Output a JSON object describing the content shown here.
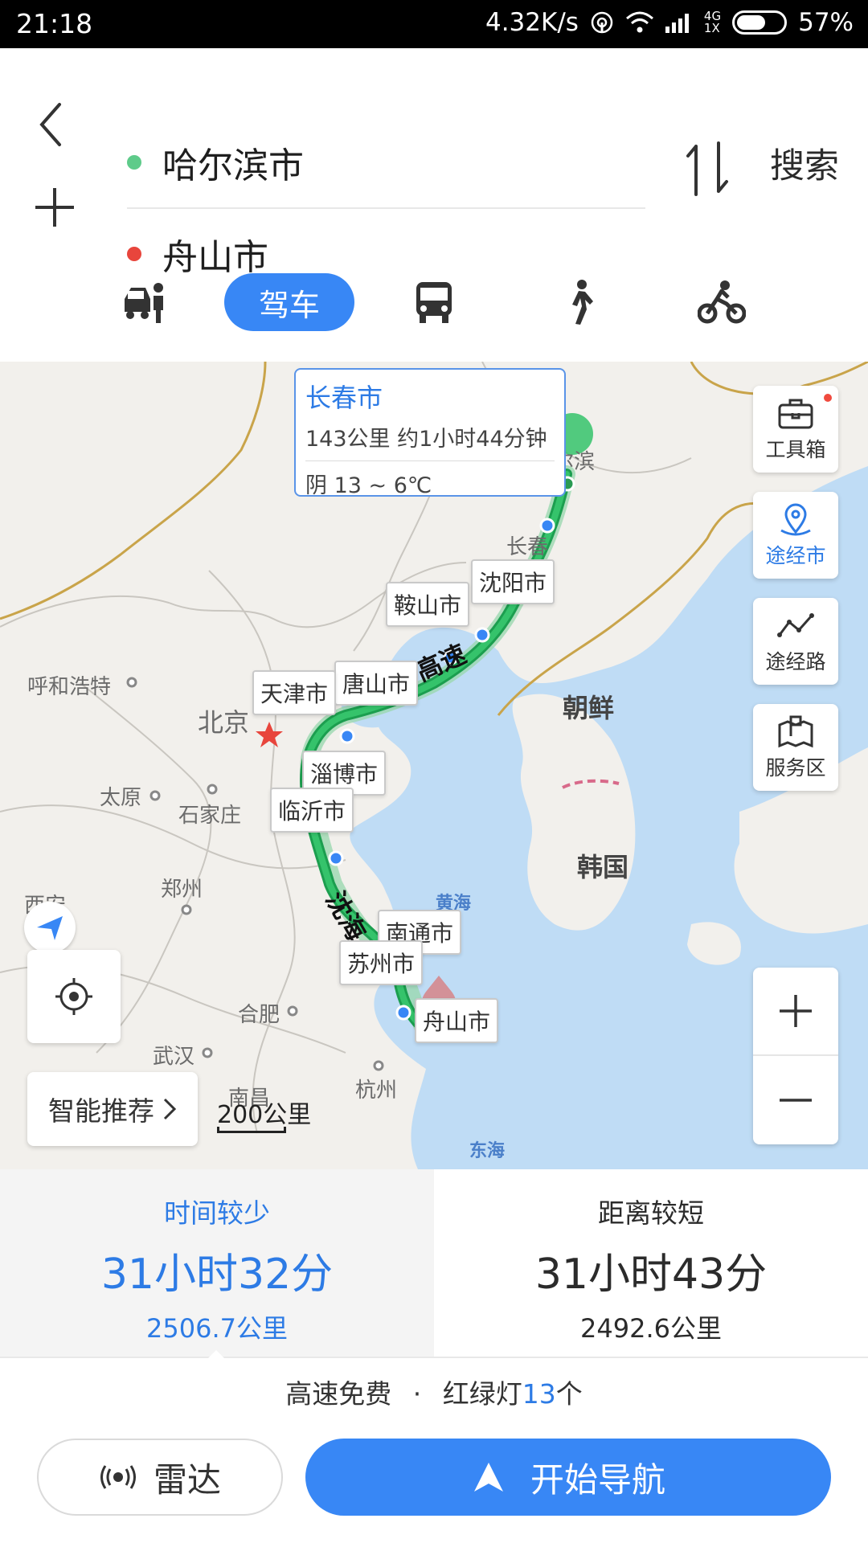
{
  "status_bar": {
    "time": "21:18",
    "net_speed": "4.32K/s",
    "network_type": "4G",
    "sim_label": "1X",
    "battery": "57%"
  },
  "route": {
    "origin": "哈尔滨市",
    "destination": "舟山市",
    "search_label": "搜索",
    "origin_color": "#5ecb8a",
    "destination_color": "#e8453c"
  },
  "modes": {
    "active_label": "驾车",
    "items": [
      "taxi-icon",
      "car",
      "bus-icon",
      "walk-icon",
      "bike-icon"
    ]
  },
  "map": {
    "info_card": {
      "city": "长春市",
      "detail": "143公里 约1小时44分钟",
      "weather": "阴 13 ~ 6℃"
    },
    "city_tags": [
      "沈阳市",
      "鞍山市",
      "唐山市",
      "天津市",
      "淄博市",
      "临沂市",
      "南通市",
      "苏州市",
      "舟山市"
    ],
    "labels": {
      "harbin": "哈尔滨",
      "changchun": "长春",
      "hohhot": "呼和浩特",
      "beijing": "北京",
      "taiyuan": "太原",
      "shijiazhuang": "石家庄",
      "zhengzhou": "郑州",
      "xian": "西安",
      "hefei": "合肥",
      "wuhan": "武汉",
      "hangzhou": "杭州",
      "nanchang": "南昌",
      "korea_north": "朝鲜",
      "korea_south": "韩国",
      "yellow_sea": "黄海",
      "east_sea": "东海",
      "road_1": "高速",
      "road_2": "沈海"
    },
    "tools": {
      "toolbox": "工具箱",
      "via_city": "途经市",
      "via_road": "途经路",
      "service_area": "服务区"
    },
    "smart_recommend": "智能推荐",
    "scale": "200公里"
  },
  "plans": [
    {
      "label": "时间较少",
      "duration": "31小时32分",
      "distance": "2506.7公里"
    },
    {
      "label": "距离较短",
      "duration": "31小时43分",
      "distance": "2492.6公里"
    }
  ],
  "summary": {
    "toll": "高速免费",
    "separator": "·",
    "lights_prefix": "红绿灯",
    "lights_count": "13",
    "lights_suffix": "个"
  },
  "actions": {
    "radar": "雷达",
    "start_nav": "开始导航"
  },
  "colors": {
    "accent": "#3887f5",
    "route_green": "#1fae5a",
    "route_alt": "#9bd8b0"
  }
}
